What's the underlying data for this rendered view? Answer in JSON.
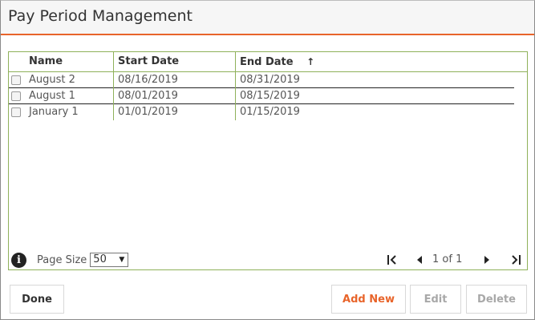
{
  "dialog": {
    "title": "Pay Period Management"
  },
  "grid": {
    "columns": {
      "name": "Name",
      "start": "Start Date",
      "end": "End Date",
      "end_sort": "↑"
    },
    "rows": [
      {
        "name": "August 2",
        "start": "08/16/2019",
        "end": "08/31/2019",
        "checked": false
      },
      {
        "name": "August 1",
        "start": "08/01/2019",
        "end": "08/15/2019",
        "checked": false
      },
      {
        "name": "January 1",
        "start": "01/01/2019",
        "end": "01/15/2019",
        "checked": false
      }
    ],
    "footer": {
      "info_icon": "info-icon",
      "info_glyph": "i",
      "page_size_label": "Page Size",
      "page_size_value": "50",
      "page_size_caret": "▼",
      "pager_text": "1 of 1"
    }
  },
  "buttons": {
    "done": "Done",
    "add_new": "Add New",
    "edit": "Edit",
    "delete": "Delete"
  },
  "colors": {
    "accent": "#e8642a",
    "grid_border": "#8fb15a",
    "disabled_text": "#a8a8a8"
  }
}
